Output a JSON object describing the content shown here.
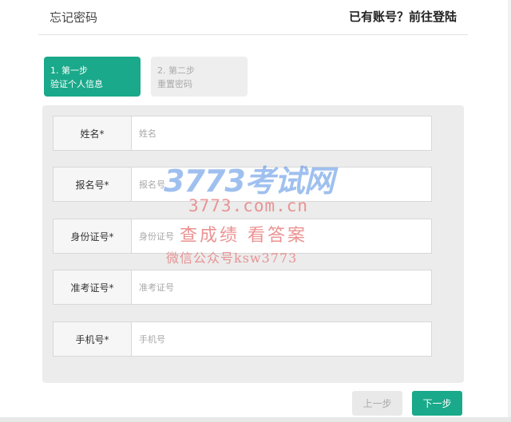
{
  "header": {
    "title": "忘记密码",
    "login_link": "已有账号？前往登陆"
  },
  "steps": [
    {
      "number": "1. 第一步",
      "label": "验证个人信息",
      "state": "active"
    },
    {
      "number": "2. 第二步",
      "label": "重置密码",
      "state": "inactive"
    }
  ],
  "form": {
    "fields": [
      {
        "label": "姓名*",
        "placeholder": "姓名",
        "value": ""
      },
      {
        "label": "报名号*",
        "placeholder": "报名号",
        "value": ""
      },
      {
        "label": "身份证号*",
        "placeholder": "身份证号",
        "value": ""
      },
      {
        "label": "准考证号*",
        "placeholder": "准考证号",
        "value": ""
      },
      {
        "label": "手机号*",
        "placeholder": "手机号",
        "value": ""
      }
    ]
  },
  "buttons": {
    "prev": "上一步",
    "next": "下一步"
  },
  "watermark": {
    "logo": "3773考试网",
    "url": "3773.com.cn",
    "slogan": "查成绩 看答案",
    "wechat": "微信公众号ksw3773"
  },
  "colors": {
    "accent": "#1aa98a",
    "panel_bg": "#ececec"
  }
}
